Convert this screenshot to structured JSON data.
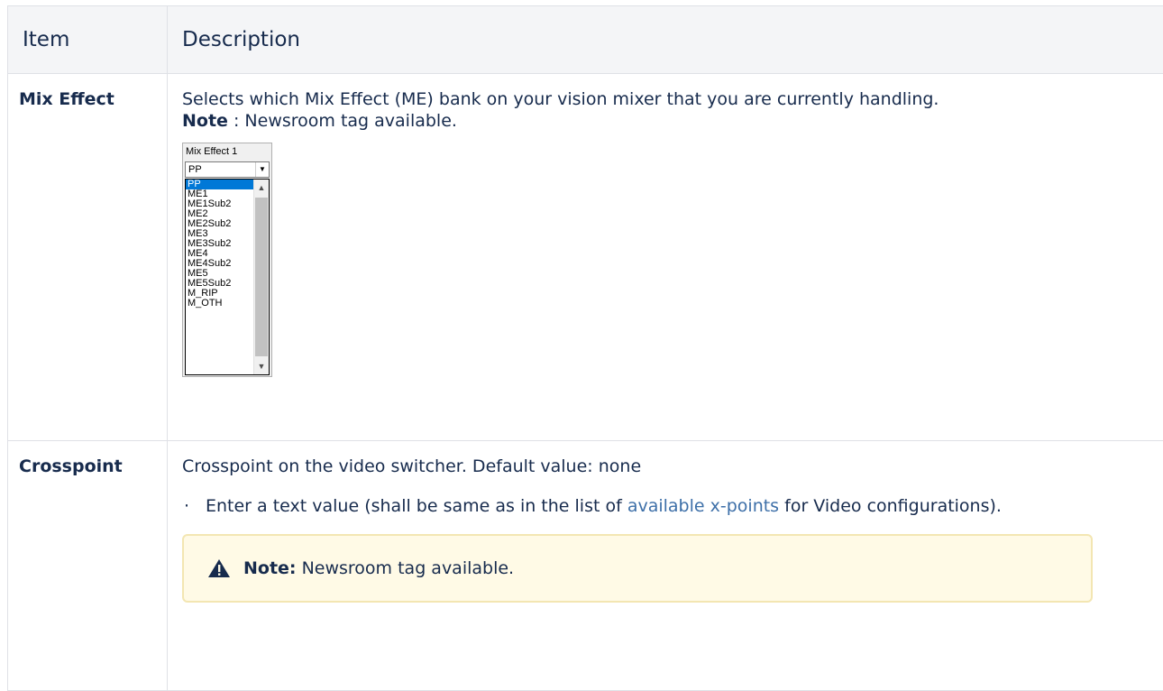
{
  "table": {
    "header": {
      "item": "Item",
      "description": "Description"
    },
    "rows": [
      {
        "item": "Mix Effect",
        "description": "Selects which Mix Effect (ME) bank on your vision mixer that you are currently handling.",
        "note_label": "Note",
        "note_text": " : Newsroom tag available.",
        "screenshot": {
          "title": "Mix Effect 1",
          "selected_value": "PP",
          "options": [
            "PP",
            "ME1",
            "ME1Sub2",
            "ME2",
            "ME2Sub2",
            "ME3",
            "ME3Sub2",
            "ME4",
            "ME4Sub2",
            "ME5",
            "ME5Sub2",
            "M_RIP",
            "M_OTH"
          ]
        }
      },
      {
        "item": "Crosspoint",
        "description": "Crosspoint on the video switcher. Default value: none",
        "bullet_prefix": "Enter a text value (shall be same as in the list of ",
        "bullet_link": "available x-points",
        "bullet_suffix": " for Video configurations).",
        "note_label": "Note:",
        "note_text": " Newsroom tag available.",
        "note_icon": "warning-icon"
      }
    ]
  },
  "colors": {
    "link": "#3d6fa8",
    "note_bg": "#fffae6",
    "header_bg": "#f4f5f7",
    "selection": "#0078d7"
  }
}
